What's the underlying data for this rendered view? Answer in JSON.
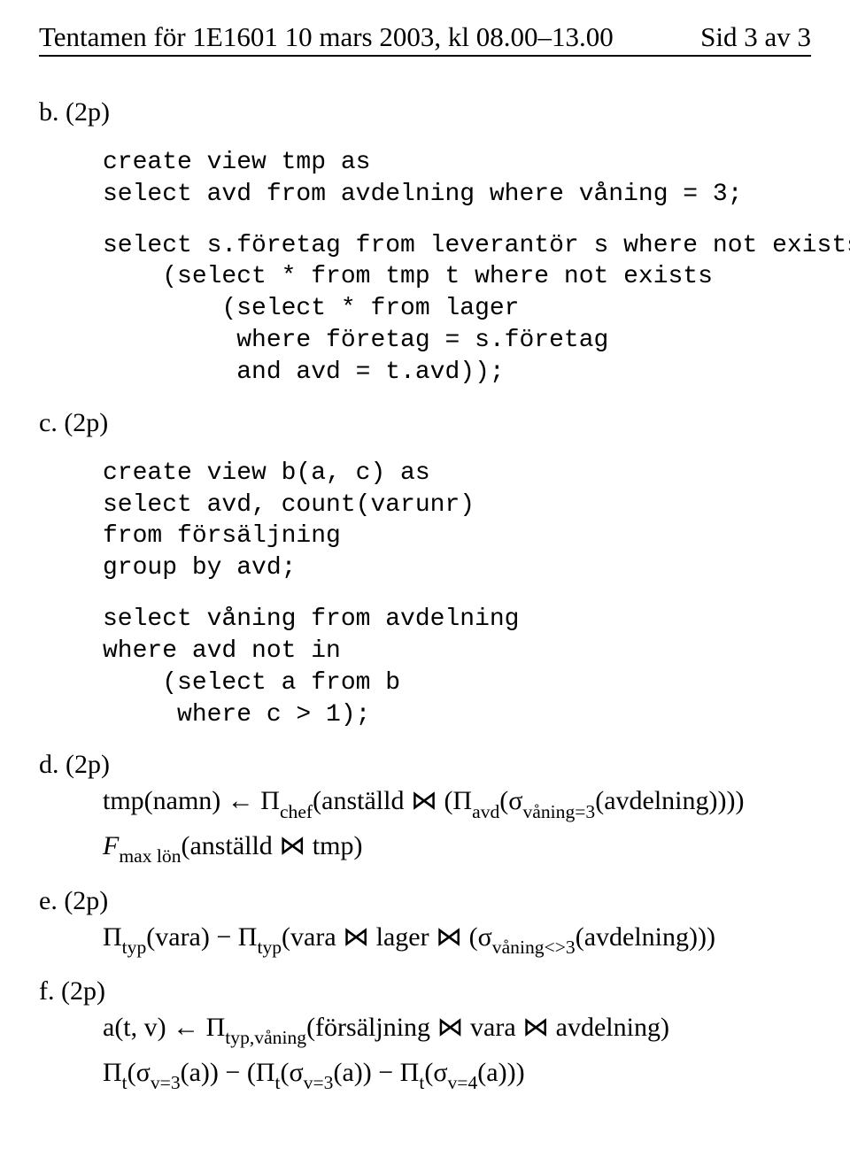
{
  "header": {
    "left": "Tentamen för 1E1601 10 mars 2003, kl 08.00–13.00",
    "right": "Sid 3 av 3"
  },
  "b": {
    "label": "b. (2p)",
    "code1": "create view tmp as\nselect avd from avdelning where våning = 3;",
    "code2": "select s.företag from leverantör s where not exists\n    (select * from tmp t where not exists\n        (select * from lager\n         where företag = s.företag\n         and avd = t.avd));"
  },
  "c": {
    "label": "c. (2p)",
    "code1": "create view b(a, c) as\nselect avd, count(varunr)\nfrom försäljning\ngroup by avd;",
    "code2": "select våning from avdelning\nwhere avd not in\n    (select a from b\n     where c > 1);"
  },
  "d": {
    "label": "d. (2p)",
    "l1_a": "tmp(namn) ← Π",
    "l1_sub1": "chef",
    "l1_b": "(anställd ⋈ (Π",
    "l1_sub2": "avd",
    "l1_c": "(σ",
    "l1_sub3": "våning=3",
    "l1_d": "(avdelning))))",
    "l2_a": "F",
    "l2_sub": "max lön",
    "l2_b": "(anställd ⋈ tmp)"
  },
  "e": {
    "label": "e. (2p)",
    "a": "Π",
    "sub1": "typ",
    "b": "(vara) − Π",
    "sub2": "typ",
    "c": "(vara ⋈ lager ⋈ (σ",
    "sub3": "våning<>3",
    "d": "(avdelning)))"
  },
  "f": {
    "label": "f. (2p)",
    "l1_a": "a(t, v) ← Π",
    "l1_sub": "typ,våning",
    "l1_b": "(försäljning ⋈ vara ⋈ avdelning)",
    "l2_a": "Π",
    "l2_sub1": "t",
    "l2_b": "(σ",
    "l2_sub2": "v=3",
    "l2_c": "(a)) − (Π",
    "l2_sub3": "t",
    "l2_d": "(σ",
    "l2_sub4": "v=3",
    "l2_e": "(a)) − Π",
    "l2_sub5": "t",
    "l2_f": "(σ",
    "l2_sub6": "v=4",
    "l2_g": "(a)))"
  }
}
